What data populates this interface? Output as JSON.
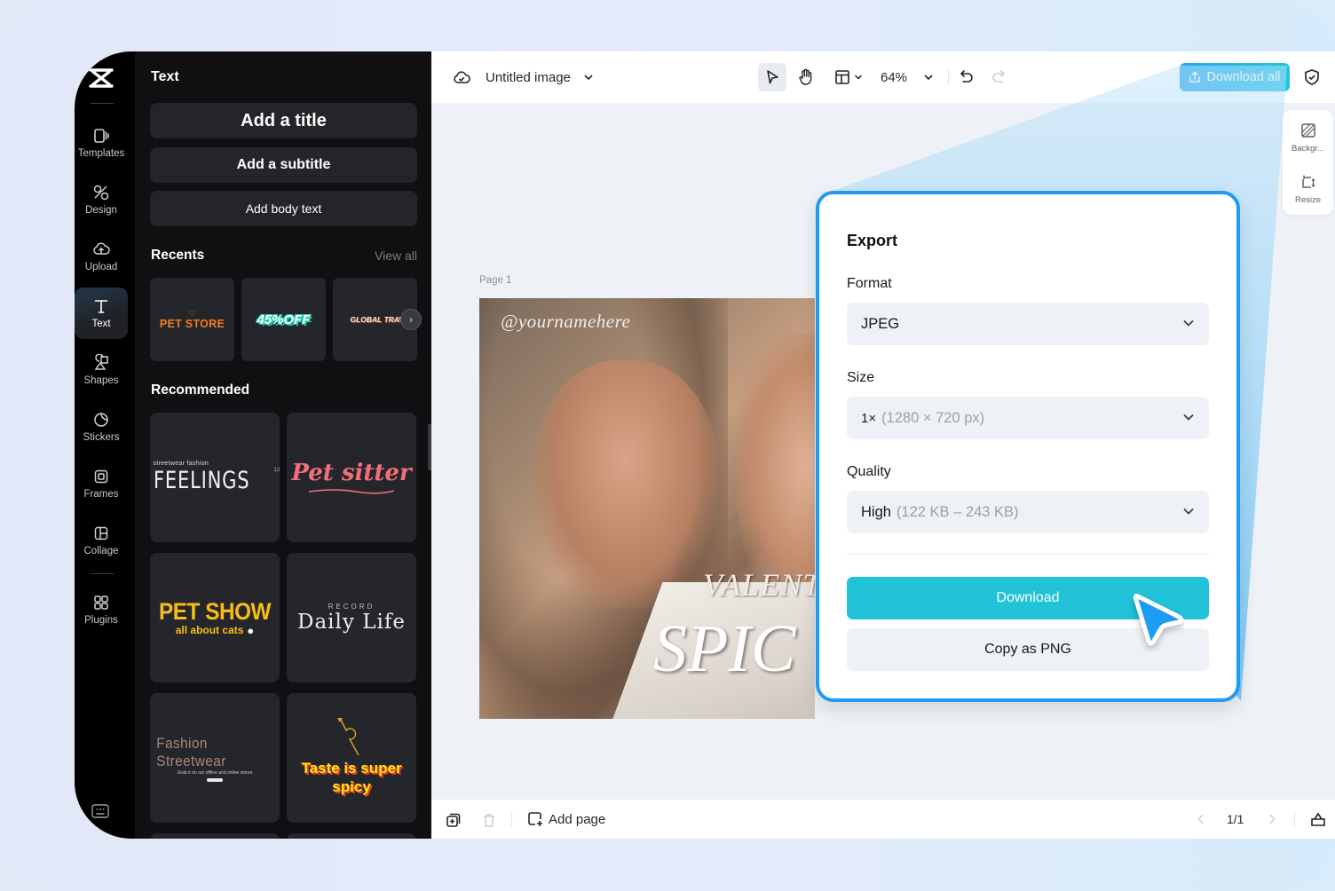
{
  "rail": {
    "logo": "capcut-logo",
    "items": [
      {
        "label": "Templates",
        "icon": "templates-icon",
        "active": false
      },
      {
        "label": "Design",
        "icon": "design-icon",
        "active": false
      },
      {
        "label": "Upload",
        "icon": "upload-cloud-icon",
        "active": false
      },
      {
        "label": "Text",
        "icon": "text-icon",
        "active": true
      },
      {
        "label": "Shapes",
        "icon": "shapes-icon",
        "active": false
      },
      {
        "label": "Stickers",
        "icon": "sticker-icon",
        "active": false
      },
      {
        "label": "Frames",
        "icon": "frames-icon",
        "active": false
      },
      {
        "label": "Collage",
        "icon": "collage-icon",
        "active": false
      },
      {
        "label": "Plugins",
        "icon": "plugins-icon",
        "active": false
      }
    ],
    "bottom_icon": "keyboard-icon"
  },
  "panel": {
    "title": "Text",
    "add_title": "Add a title",
    "add_subtitle": "Add a subtitle",
    "add_body": "Add body text",
    "recents_label": "Recents",
    "view_all": "View all",
    "recents": [
      {
        "text": "PET STORE",
        "color": "#f47a1f"
      },
      {
        "text": "45%OFF",
        "color": "#1fd6b0"
      },
      {
        "text": "GLOBAL TRAVE",
        "color": "#f1e6de"
      }
    ],
    "recommended_label": "Recommended",
    "recommended": [
      {
        "top": "streetwear fashion",
        "main": "FEELINGS",
        "badge": "12"
      },
      {
        "main": "Pet sitter"
      },
      {
        "main": "PET SHOW",
        "sub": "all about cats"
      },
      {
        "top": "RECORD",
        "main": "Daily Life"
      },
      {
        "main": "Fashion Streetwear",
        "sub": "Grab it on our offline and online stores"
      },
      {
        "main": "Taste is super spicy"
      }
    ]
  },
  "topbar": {
    "doc_title": "Untitled image",
    "zoom": "64%",
    "download_all": "Download all"
  },
  "canvas": {
    "page_label": "Page 1",
    "artwork": {
      "handle": "@yournamehere",
      "line1": "VALENT",
      "line2": "SPIC"
    }
  },
  "side_tools": [
    {
      "label": "Backgr...",
      "icon": "background-icon"
    },
    {
      "label": "Resize",
      "icon": "resize-icon"
    }
  ],
  "export": {
    "title": "Export",
    "format_label": "Format",
    "format_value": "JPEG",
    "size_label": "Size",
    "size_value": "1×",
    "size_detail": "(1280 × 720 px)",
    "quality_label": "Quality",
    "quality_value": "High",
    "quality_detail": "(122 KB – 243 KB)",
    "download": "Download",
    "copy_png": "Copy as PNG"
  },
  "bottombar": {
    "add_page": "Add page",
    "page_indicator": "1/1"
  },
  "colors": {
    "accent": "#1e9bf0",
    "download_button": "#22c2d9",
    "dark_bg": "#101012"
  }
}
